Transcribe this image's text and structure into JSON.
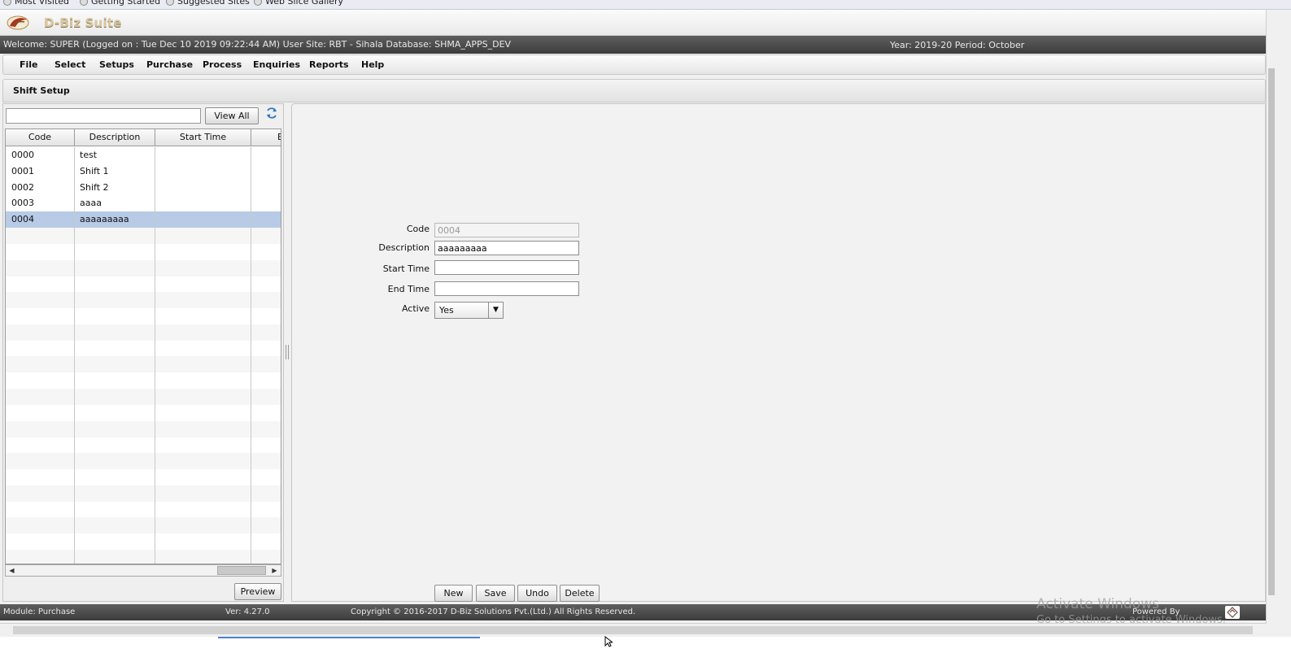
{
  "bookmarks": [
    "Most Visited",
    "Getting Started",
    "Suggested Sites",
    "Web Slice Gallery"
  ],
  "app": {
    "brand": "D-Biz Suite"
  },
  "session": {
    "welcome": "Welcome: SUPER (Logged on : Tue Dec 10 2019 09:22:44 AM) User Site: RBT - Sihala Database: SHMA_APPS_DEV",
    "period": "Year: 2019-20 Period: October"
  },
  "menu": [
    "File",
    "Select",
    "Setups",
    "Purchase",
    "Process",
    "Enquiries",
    "Reports",
    "Help"
  ],
  "page": {
    "title": "Shift Setup"
  },
  "list": {
    "search_value": "",
    "view_all_label": "View All",
    "columns": [
      "Code",
      "Description",
      "Start Time",
      "E"
    ],
    "rows": [
      {
        "code": "0000",
        "description": "test",
        "start_time": ""
      },
      {
        "code": "0001",
        "description": "Shift 1",
        "start_time": ""
      },
      {
        "code": "0002",
        "description": "Shift 2",
        "start_time": ""
      },
      {
        "code": "0003",
        "description": "aaaa",
        "start_time": ""
      },
      {
        "code": "0004",
        "description": "aaaaaaaaa",
        "start_time": ""
      }
    ],
    "selected_code": "0004",
    "preview_label": "Preview"
  },
  "form": {
    "code_label": "Code",
    "code_value": "0004",
    "description_label": "Description",
    "description_value": "aaaaaaaaa",
    "start_time_label": "Start Time",
    "start_time_value": "",
    "end_time_label": "End Time",
    "end_time_value": "",
    "active_label": "Active",
    "active_value": "Yes"
  },
  "actions": {
    "new": "New",
    "save": "Save",
    "undo": "Undo",
    "delete": "Delete"
  },
  "footer": {
    "module": "Module: Purchase",
    "version": "Ver: 4.27.0",
    "copyright": "Copyright © 2016-2017 D-Biz Solutions Pvt.(Ltd.) All Rights Reserved.",
    "powered_by": "Powered By"
  },
  "watermark": {
    "title": "Activate Windows",
    "subtitle": "Go to Settings to activate Windows."
  },
  "icons": [
    "home-icon",
    "settings-icon",
    "lock-icon",
    "refresh-icon",
    "app-logo-icon"
  ],
  "colors": {
    "selected_row": "#b7cbe6",
    "header_dark": "#4a4a4a"
  }
}
